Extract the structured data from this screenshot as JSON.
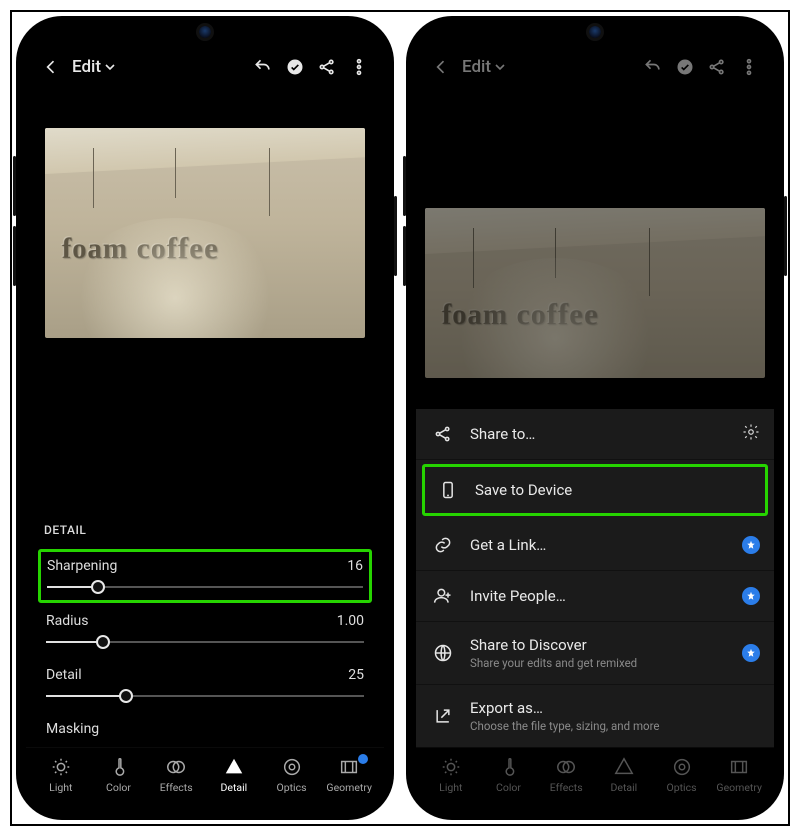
{
  "phones": {
    "left": {
      "topbar": {
        "title": "Edit"
      },
      "photo_text": "foam coffee",
      "panel": {
        "heading": "DETAIL",
        "sliders": {
          "sharpening": {
            "label": "Sharpening",
            "value": "16",
            "percent": 16,
            "highlight": true
          },
          "radius": {
            "label": "Radius",
            "value": "1.00",
            "percent": 18
          },
          "detail": {
            "label": "Detail",
            "value": "25",
            "percent": 25
          },
          "masking": {
            "label": "Masking",
            "value": "",
            "percent": 0
          }
        }
      },
      "tabs": {
        "light": {
          "label": "Light"
        },
        "color": {
          "label": "Color"
        },
        "effects": {
          "label": "Effects"
        },
        "detail": {
          "label": "Detail",
          "active": true
        },
        "optics": {
          "label": "Optics"
        },
        "geometry": {
          "label": "Geometry",
          "badge": true
        }
      }
    },
    "right": {
      "topbar": {
        "title": "Edit"
      },
      "photo_text": "foam coffee",
      "sheet": {
        "share": {
          "label": "Share to…"
        },
        "save": {
          "label": "Save to Device",
          "highlight": true
        },
        "link": {
          "label": "Get a Link…",
          "premium": true
        },
        "invite": {
          "label": "Invite People…",
          "premium": true
        },
        "discover": {
          "label": "Share to Discover",
          "sub": "Share your edits and get remixed",
          "premium": true
        },
        "export": {
          "label": "Export as…",
          "sub": "Choose the file type, sizing, and more"
        }
      },
      "tabs": {
        "light": {
          "label": "Light"
        },
        "color": {
          "label": "Color"
        },
        "effects": {
          "label": "Effects"
        },
        "detail": {
          "label": "Detail"
        },
        "optics": {
          "label": "Optics"
        },
        "geometry": {
          "label": "Geometry"
        }
      }
    }
  }
}
